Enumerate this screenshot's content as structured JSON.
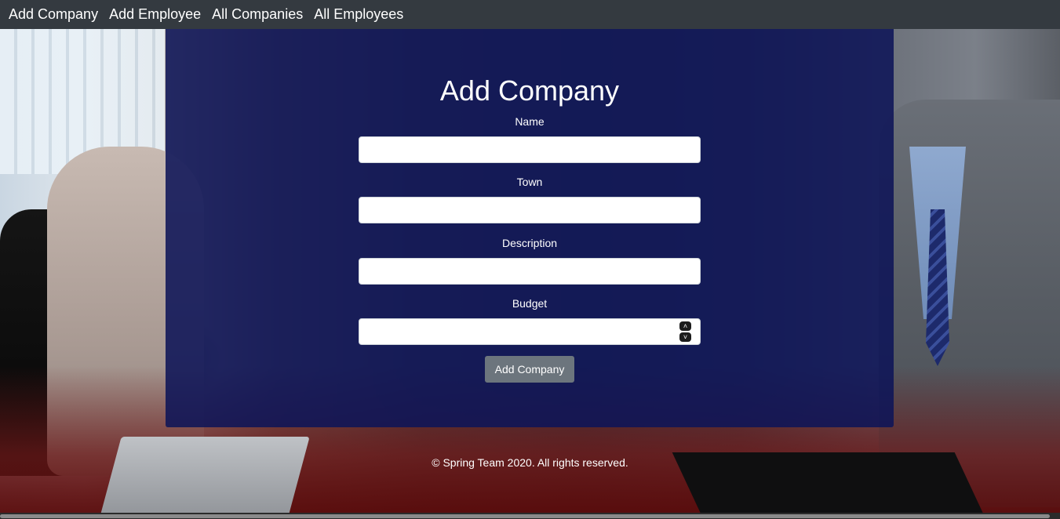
{
  "nav": {
    "items": [
      {
        "label": "Add Company"
      },
      {
        "label": "Add Employee"
      },
      {
        "label": "All Companies"
      },
      {
        "label": "All Employees"
      }
    ]
  },
  "form": {
    "title": "Add Company",
    "fields": [
      {
        "label": "Name",
        "value": ""
      },
      {
        "label": "Town",
        "value": ""
      },
      {
        "label": "Description",
        "value": ""
      },
      {
        "label": "Budget",
        "value": ""
      }
    ],
    "submit_label": "Add Company"
  },
  "footer": {
    "text": "© Spring Team 2020. All rights reserved."
  },
  "colors": {
    "navbar": "#343a40",
    "panel": "#0e1458",
    "button": "#6c757d"
  }
}
